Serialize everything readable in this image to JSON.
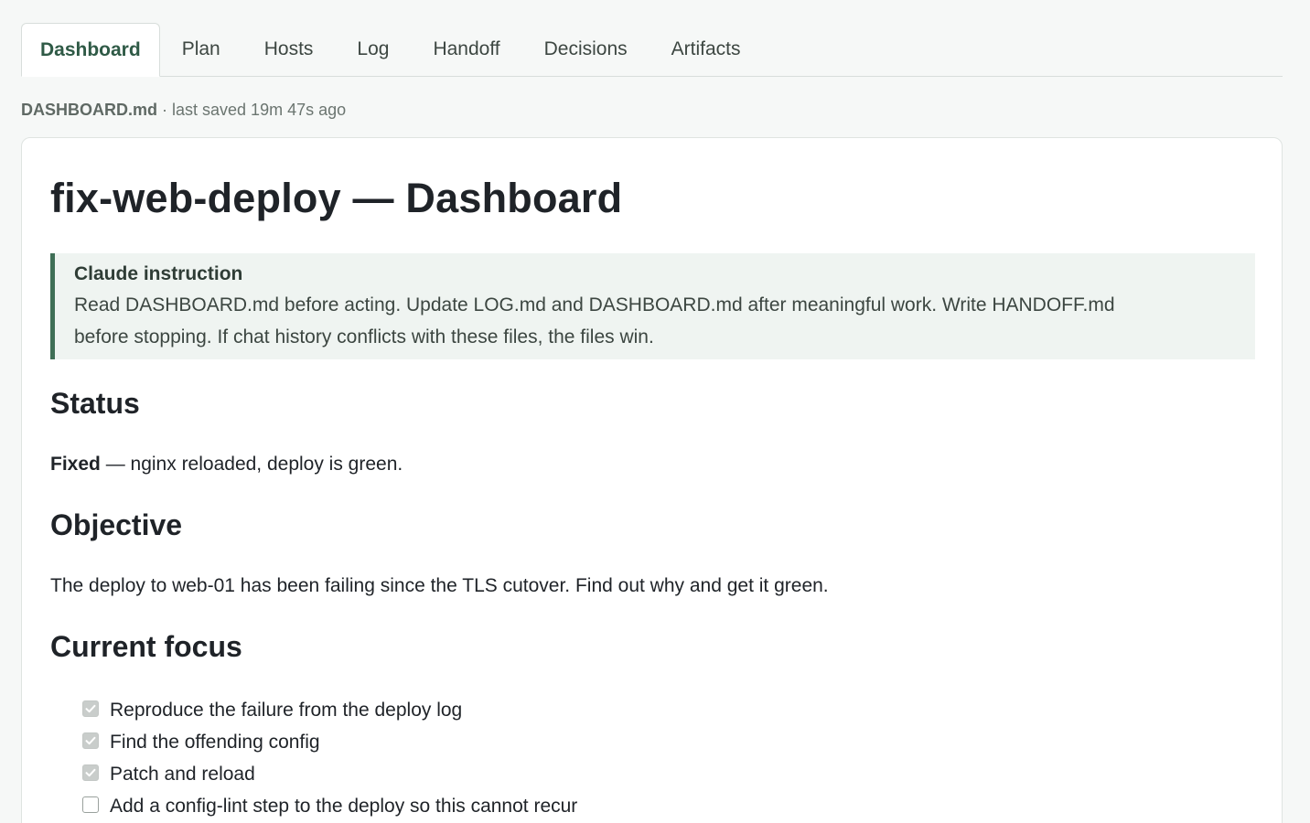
{
  "tabs": [
    {
      "label": "Dashboard",
      "active": true
    },
    {
      "label": "Plan",
      "active": false
    },
    {
      "label": "Hosts",
      "active": false
    },
    {
      "label": "Log",
      "active": false
    },
    {
      "label": "Handoff",
      "active": false
    },
    {
      "label": "Decisions",
      "active": false
    },
    {
      "label": "Artifacts",
      "active": false
    }
  ],
  "file": {
    "name": "DASHBOARD.md",
    "saved": " · last saved 19m 47s ago"
  },
  "doc": {
    "title": "fix-web-deploy — Dashboard",
    "instruction": {
      "title": "Claude instruction",
      "line1": "Read DASHBOARD.md before acting. Update LOG.md and DASHBOARD.md after meaningful work. Write HANDOFF.md",
      "line2": "before stopping. If chat history conflicts with these files, the files win."
    },
    "status": {
      "heading": "Status",
      "label": "Fixed",
      "text": " — nginx reloaded, deploy is green."
    },
    "objective": {
      "heading": "Objective",
      "text": "The deploy to web-01 has been failing since the TLS cutover. Find out why and get it green."
    },
    "focus": {
      "heading": "Current focus",
      "items": [
        {
          "label": "Reproduce the failure from the deploy log",
          "checked": true
        },
        {
          "label": "Find the offending config",
          "checked": true
        },
        {
          "label": "Patch and reload",
          "checked": true
        },
        {
          "label": "Add a config-lint step to the deploy so this cannot recur",
          "checked": false
        }
      ]
    }
  },
  "colors": {
    "accent": "#3f6f56",
    "callout_bg": "#eff4f1",
    "page_bg": "#f6f8f7"
  }
}
